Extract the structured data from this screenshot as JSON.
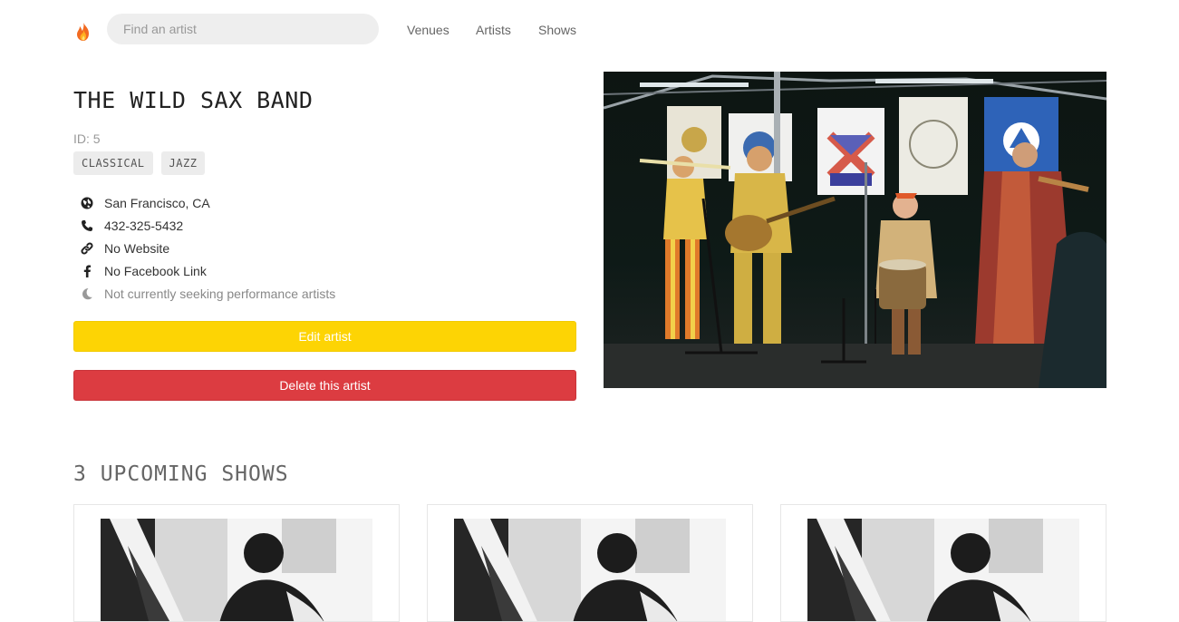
{
  "nav": {
    "search_placeholder": "Find an artist",
    "links": [
      "Venues",
      "Artists",
      "Shows"
    ]
  },
  "artist": {
    "name": "THE WILD SAX BAND",
    "id_text": "ID: 5",
    "genres": [
      "CLASSICAL",
      "JAZZ"
    ],
    "info": [
      {
        "icon": "globe-icon",
        "text": "San Francisco, CA"
      },
      {
        "icon": "phone-icon",
        "text": "432-325-5432"
      },
      {
        "icon": "link-icon",
        "text": "No Website"
      },
      {
        "icon": "facebook-icon",
        "text": "No Facebook Link"
      },
      {
        "icon": "moon-icon",
        "text": "Not currently seeking performance artists"
      }
    ],
    "edit_label": "Edit artist",
    "delete_label": "Delete this artist"
  },
  "shows": {
    "heading": "3 UPCOMING SHOWS",
    "count": 3
  },
  "colors": {
    "edit": "#fdd404",
    "delete": "#dc3c41"
  }
}
